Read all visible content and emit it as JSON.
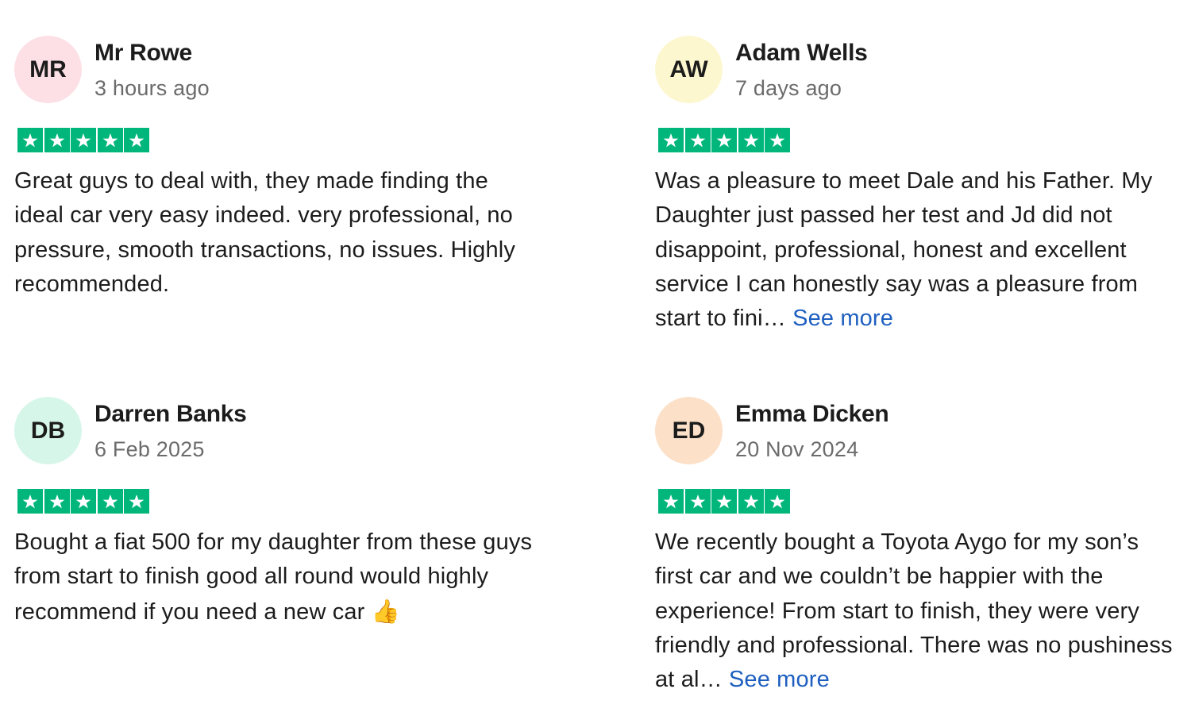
{
  "colors": {
    "star_green": "#00b67a",
    "link_blue": "#1e5fc0",
    "meta_gray": "#6b6b6b"
  },
  "reviews": [
    {
      "initials": "MR",
      "avatar_color": "#fde0e6",
      "name": "Mr Rowe",
      "date": "3 hours ago",
      "rating": 5,
      "text": "Great guys to deal with, they made finding the ideal car very easy indeed. very professional, no pressure, smooth transactions, no issues. Highly recommended.",
      "see_more": ""
    },
    {
      "initials": "AW",
      "avatar_color": "#fdf7cf",
      "name": "Adam Wells",
      "date": "7 days ago",
      "rating": 5,
      "text": "Was a pleasure to meet Dale and his Father. My Daughter just passed her test and Jd did not disappoint, professional, honest and excellent service I can honestly say was a pleasure from start to fini… ",
      "see_more": "See more"
    },
    {
      "initials": "DB",
      "avatar_color": "#d6f6e9",
      "name": "Darren Banks",
      "date": "6 Feb 2025",
      "rating": 5,
      "text": "Bought a fiat 500 for my daughter from these guys from start to finish good all round would highly recommend if you need a new car ",
      "emoji": "👍",
      "see_more": ""
    },
    {
      "initials": "ED",
      "avatar_color": "#fde0c8",
      "name": "Emma Dicken",
      "date": "20 Nov 2024",
      "rating": 5,
      "text": "We recently bought a Toyota Aygo for my son’s first car and we couldn’t be happier with the experience! From start to finish, they were very friendly and professional. There was no pushiness at al… ",
      "see_more": "See more"
    }
  ]
}
